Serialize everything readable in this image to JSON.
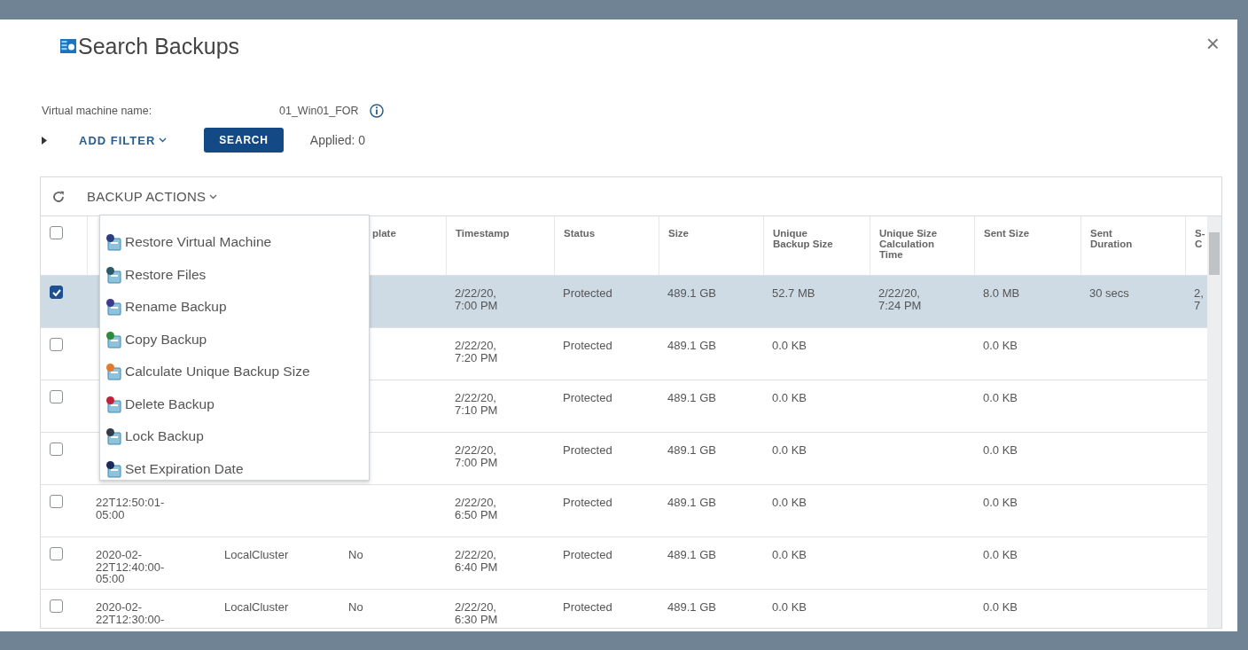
{
  "dialog": {
    "title": "Search Backups",
    "close": "×"
  },
  "filter": {
    "label": "Virtual machine name:",
    "value": "01_Win01_FOR",
    "add_filter": "ADD FILTER",
    "search_button": "SEARCH",
    "applied": "Applied: 0"
  },
  "toolbar": {
    "backup_actions": "BACKUP ACTIONS"
  },
  "menu": [
    {
      "label": "Restore Virtual Machine",
      "color": "#2c3e80"
    },
    {
      "label": "Restore Files",
      "color": "#2a5a6a"
    },
    {
      "label": "Rename Backup",
      "color": "#3b3b8a"
    },
    {
      "label": "Copy Backup",
      "color": "#2e8b3e"
    },
    {
      "label": "Calculate Unique Backup Size",
      "color": "#e07b30"
    },
    {
      "label": "Delete Backup",
      "color": "#c0203a"
    },
    {
      "label": "Lock Backup",
      "color": "#333c4a"
    },
    {
      "label": "Set Expiration Date",
      "color": "#1a2a5a"
    }
  ],
  "table": {
    "select_all": false,
    "columns": [
      null,
      null,
      "plate",
      "Timestamp",
      "Status",
      "Size",
      "Unique\nBackup Size",
      "Unique Size\nCalculation\nTime",
      "Sent Size",
      "Sent\nDuration",
      "S-\nC"
    ],
    "rows": [
      {
        "selected": true,
        "cells": [
          null,
          null,
          null,
          "2/22/20,\n7:00 PM",
          "Protected",
          "489.1 GB",
          "52.7 MB",
          "2/22/20,\n7:24 PM",
          "8.0 MB",
          "30 secs",
          "2,\n7"
        ]
      },
      {
        "selected": false,
        "cells": [
          null,
          null,
          null,
          "2/22/20,\n7:20 PM",
          "Protected",
          "489.1 GB",
          "0.0 KB",
          null,
          "0.0 KB",
          null,
          null
        ]
      },
      {
        "selected": false,
        "cells": [
          null,
          null,
          null,
          "2/22/20,\n7:10 PM",
          "Protected",
          "489.1 GB",
          "0.0 KB",
          null,
          "0.0 KB",
          null,
          null
        ]
      },
      {
        "selected": false,
        "cells": [
          null,
          null,
          null,
          "2/22/20,\n7:00 PM",
          "Protected",
          "489.1 GB",
          "0.0 KB",
          null,
          "0.0 KB",
          null,
          null
        ]
      },
      {
        "selected": false,
        "cells": [
          "22T12:50:01-\n05:00",
          null,
          null,
          "2/22/20,\n6:50 PM",
          "Protected",
          "489.1 GB",
          "0.0 KB",
          null,
          "0.0 KB",
          null,
          null
        ]
      },
      {
        "selected": false,
        "cells": [
          "2020-02-\n22T12:40:00-\n05:00",
          "LocalCluster",
          "No",
          "2/22/20,\n6:40 PM",
          "Protected",
          "489.1 GB",
          "0.0 KB",
          null,
          "0.0 KB",
          null,
          null
        ]
      },
      {
        "selected": false,
        "cells": [
          "2020-02-\n22T12:30:00-",
          "LocalCluster",
          "No",
          "2/22/20,\n6:30 PM",
          "Protected",
          "489.1 GB",
          "0.0 KB",
          null,
          "0.0 KB",
          null,
          null
        ]
      }
    ]
  }
}
